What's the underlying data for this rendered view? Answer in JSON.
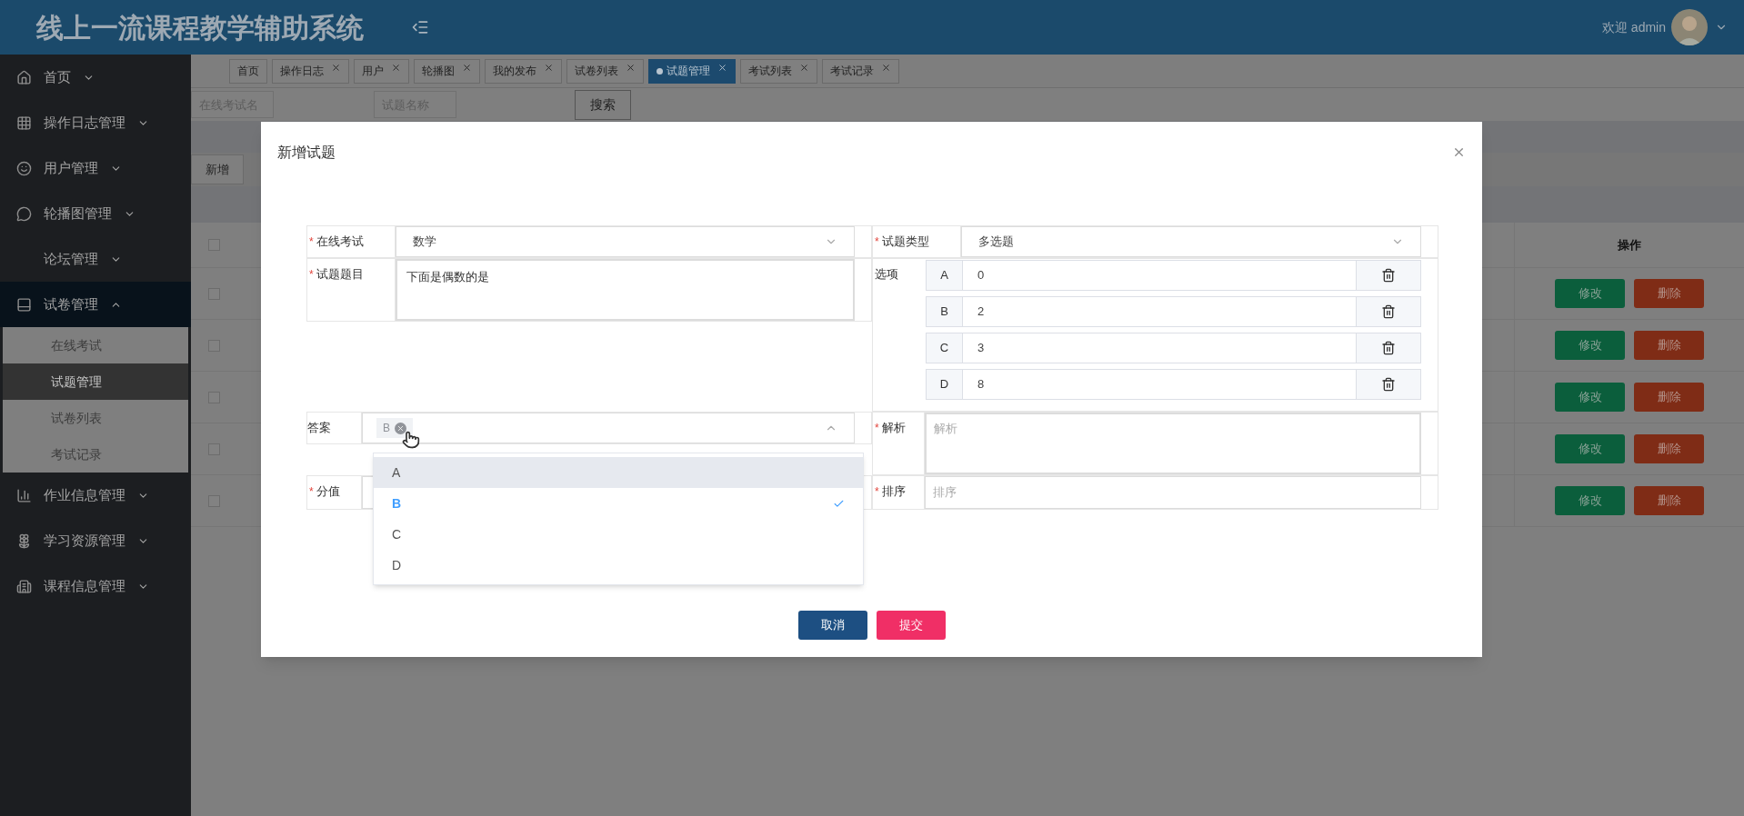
{
  "header": {
    "title": "线上一流课程教学辅助系统",
    "welcome": "欢迎 admin"
  },
  "sidebar": {
    "items": [
      {
        "label": "首页",
        "expanded": false
      },
      {
        "label": "操作日志管理",
        "expanded": false
      },
      {
        "label": "用户管理",
        "expanded": false
      },
      {
        "label": "轮播图管理",
        "expanded": false
      },
      {
        "label": "论坛管理",
        "expanded": false
      },
      {
        "label": "试卷管理",
        "expanded": true,
        "children": [
          {
            "label": "在线考试",
            "selected": false
          },
          {
            "label": "试题管理",
            "selected": true
          },
          {
            "label": "试卷列表",
            "selected": false
          },
          {
            "label": "考试记录",
            "selected": false
          }
        ]
      },
      {
        "label": "作业信息管理",
        "expanded": false
      },
      {
        "label": "学习资源管理",
        "expanded": false
      },
      {
        "label": "课程信息管理",
        "expanded": false
      }
    ]
  },
  "tabs": [
    {
      "label": "首页",
      "selected": false,
      "closable": false
    },
    {
      "label": "操作日志",
      "selected": false,
      "closable": true
    },
    {
      "label": "用户",
      "selected": false,
      "closable": true
    },
    {
      "label": "轮播图",
      "selected": false,
      "closable": true
    },
    {
      "label": "我的发布",
      "selected": false,
      "closable": true
    },
    {
      "label": "试卷列表",
      "selected": false,
      "closable": true
    },
    {
      "label": "试题管理",
      "selected": true,
      "closable": true
    },
    {
      "label": "考试列表",
      "selected": false,
      "closable": true
    },
    {
      "label": "考试记录",
      "selected": false,
      "closable": true
    }
  ],
  "search": {
    "fields": [
      {
        "placeholder": "在线考试名"
      },
      {
        "placeholder": "试题名称"
      }
    ],
    "button": "搜索"
  },
  "toolbar": {
    "buttons": [
      "新增"
    ]
  },
  "table": {
    "action_column": "操作",
    "header_checked": false,
    "rows": [
      {
        "checked": false,
        "actions": [
          "修改",
          "删除"
        ]
      },
      {
        "checked": false,
        "actions": [
          "修改",
          "删除"
        ]
      },
      {
        "checked": false,
        "actions": [
          "修改",
          "删除"
        ]
      },
      {
        "checked": false,
        "actions": [
          "修改",
          "删除"
        ]
      },
      {
        "checked": false,
        "actions": [
          "修改",
          "删除"
        ]
      }
    ]
  },
  "dialog": {
    "title": "新增试题",
    "required_mark": "*",
    "exam": {
      "label": "在线考试",
      "required": true,
      "value": "数学"
    },
    "type": {
      "label": "试题类型",
      "required": true,
      "value": "多选题"
    },
    "question": {
      "label": "试题题目",
      "required": true,
      "value": "下面是偶数的是"
    },
    "options": {
      "label": "选项",
      "items": [
        {
          "key": "A",
          "value": "0"
        },
        {
          "key": "B",
          "value": "2"
        },
        {
          "key": "C",
          "value": "3"
        },
        {
          "key": "D",
          "value": "8"
        }
      ]
    },
    "answer": {
      "label": "答案",
      "required": false,
      "tags": [
        "B"
      ],
      "expanded": true,
      "choices": [
        {
          "label": "A",
          "selected": false,
          "hovered": true
        },
        {
          "label": "B",
          "selected": true,
          "hovered": false
        },
        {
          "label": "C",
          "selected": false,
          "hovered": false
        },
        {
          "label": "D",
          "selected": false,
          "hovered": false
        }
      ]
    },
    "analysis": {
      "label": "解析",
      "required": true,
      "placeholder": "解析"
    },
    "score": {
      "label": "分值",
      "required": true
    },
    "sort": {
      "label": "排序",
      "required": true,
      "placeholder": "排序"
    },
    "buttons": [
      {
        "label": "取消",
        "kind": "cancel"
      },
      {
        "label": "提交",
        "kind": "submit"
      }
    ]
  }
}
